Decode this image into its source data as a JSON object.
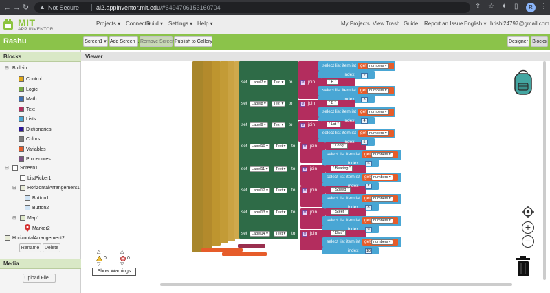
{
  "browser": {
    "security_label": "Not Secure",
    "url_host": "ai2.appinventor.mit.edu",
    "url_hash": "/#6494706153160704",
    "profile_initial": "R"
  },
  "header": {
    "logo_text": "MIT",
    "logo_sub": "APP INVENTOR",
    "menus": [
      "Projects",
      "Connect",
      "Build",
      "Settings",
      "Help"
    ],
    "right_links": [
      "My Projects",
      "View Trash",
      "Guide",
      "Report an Issue",
      "English",
      "hrishi24797@gmail.com"
    ]
  },
  "toolbar": {
    "project_name": "Rashu",
    "screen_selector": "Screen1",
    "add_screen": "Add Screen ...",
    "remove_screen": "Remove Screen",
    "publish": "Publish to Gallery",
    "designer": "Designer",
    "blocks": "Blocks"
  },
  "blocks_panel": {
    "title": "Blocks",
    "builtin_label": "Built-in",
    "builtin": [
      {
        "label": "Control",
        "color": "#e1a91a"
      },
      {
        "label": "Logic",
        "color": "#77ab41"
      },
      {
        "label": "Math",
        "color": "#3f71b5"
      },
      {
        "label": "Text",
        "color": "#b32d5e"
      },
      {
        "label": "Lists",
        "color": "#49a6d4"
      },
      {
        "label": "Dictionaries",
        "color": "#2d1799"
      },
      {
        "label": "Colors",
        "color": "#7d7d7d"
      },
      {
        "label": "Variables",
        "color": "#e65c2a"
      },
      {
        "label": "Procedures",
        "color": "#7c5385"
      }
    ],
    "screen": "Screen1",
    "components": [
      {
        "label": "ListPicker1",
        "level": 1
      },
      {
        "label": "HorizontalArrangement1",
        "level": 1
      },
      {
        "label": "Button1",
        "level": 2
      },
      {
        "label": "Button2",
        "level": 2
      },
      {
        "label": "Map1",
        "level": 1
      },
      {
        "label": "Marker2",
        "level": 2
      },
      {
        "label": "HorizontalArrangement2",
        "level": 1
      }
    ],
    "rename": "Rename",
    "delete": "Delete"
  },
  "media_panel": {
    "title": "Media",
    "upload": "Upload File ..."
  },
  "viewer": {
    "title": "Viewer",
    "warnings_count": "0",
    "errors_count": "0",
    "show_warnings": "Show Warnings"
  },
  "code_blocks": {
    "set_word": "set",
    "text_prop": "Text",
    "to_word": "to",
    "join_word": "join",
    "select_label": "select list item",
    "list_label": "list",
    "get_word": "get",
    "var_name": "numbers",
    "index_label": "index",
    "top_index": "2",
    "rows": [
      {
        "label": "Label7",
        "string": "R",
        "index": "3"
      },
      {
        "label": "Label8",
        "string": "B",
        "index": "4"
      },
      {
        "label": "Label9",
        "string": "Lat",
        "index": "5"
      },
      {
        "label": "Label10",
        "string": "Long",
        "index": "6"
      },
      {
        "label": "Label11",
        "string": "Bearing",
        "index": "7"
      },
      {
        "label": "Label12",
        "string": "Speed",
        "index": "8"
      },
      {
        "label": "Label13",
        "string": "Steer",
        "index": "9"
      },
      {
        "label": "Label14",
        "string": "Dist",
        "index": "10"
      }
    ]
  },
  "colors": {
    "accent_green": "#8bc34a",
    "event_green": "#2e6b47",
    "text_magenta": "#b32d5e",
    "list_blue": "#49a6d4",
    "var_orange": "#e65c2a",
    "control_gold": "#b38a2c"
  }
}
